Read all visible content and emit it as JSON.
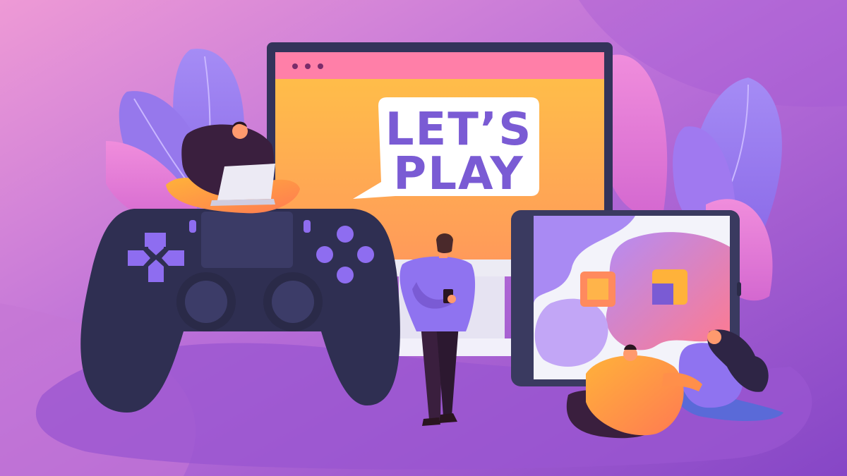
{
  "illustration": {
    "speech_bubble": {
      "line1": "LET’S",
      "line2": "PLAY"
    },
    "colors": {
      "background_top": "#e596d6",
      "background_mid": "#b86fd9",
      "background_bottom": "#8a4cc9",
      "monitor_frame": "#34345a",
      "monitor_screen": "#ffb347",
      "monitor_titlebar": "#ff7fa8",
      "controller": "#303052",
      "controller_buttons": "#8e6df0",
      "tablet_frame": "#3a3a60",
      "accent_orange": "#ff9d3a",
      "accent_pink": "#ff6f93"
    },
    "elements": [
      "gamepad-controller",
      "desktop-monitor",
      "tablet",
      "person-standing-with-phone",
      "person-sitting-on-controller-with-laptop",
      "people-sitting-by-tablet",
      "decorative-leaves"
    ]
  }
}
